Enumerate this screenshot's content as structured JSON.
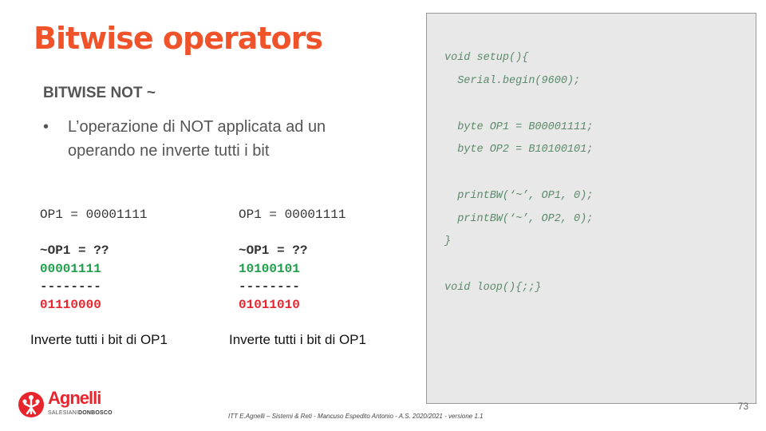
{
  "title": "Bitwise operators",
  "subtitle": "BITWISE NOT ~",
  "bullet": {
    "dot": "•",
    "text": "L’operazione di NOT applicata ad un operando ne inverte tutti i bit"
  },
  "examples": [
    {
      "line1": "OP1 = 00001111",
      "line2": "~OP1 = ??",
      "operand": "00001111",
      "separator": "--------",
      "result": "01110000",
      "caption": "Inverte tutti i bit di OP1"
    },
    {
      "line1": "OP1 = 00001111",
      "line2": "~OP1 = ??",
      "operand": "10100101",
      "separator": "--------",
      "result": "01011010",
      "caption": "Inverte tutti i bit di OP1"
    }
  ],
  "code": [
    "void setup(){",
    "  Serial.begin(9600);",
    "  byte OP1 = B00001111;",
    "  byte OP2 = B10100101;",
    "  printBW(‘~’, OP1, 0);",
    "  printBW(‘~’, OP2, 0);",
    "}",
    "void loop(){;;}"
  ],
  "page_number": "73",
  "footer": "ITT E.Agnelli – Sistemi & Reti - Mancuso Espedito Antonio - A.S. 2020/2021 - versione 1.1",
  "logo": {
    "name": "Agnelli",
    "sub_a": "SALESIANI",
    "sub_b": "DONBOSCO"
  },
  "colors": {
    "title": "#f0532a",
    "code": "#5b8a6a",
    "green": "#1f9e4a",
    "red": "#e8252d",
    "logo": "#e8252d"
  }
}
